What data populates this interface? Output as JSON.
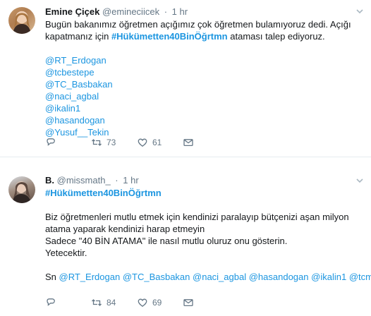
{
  "tweets": [
    {
      "name": "Emine Çiçek",
      "handle": "@emineciicek",
      "time": "1 hr",
      "lines": [
        [
          {
            "t": "Bugün bakanımız öğretmen açığımız çok öğretmen bulamıyoruz dedi. Açığı",
            "k": "text"
          }
        ],
        [
          {
            "t": "kapatmanız için ",
            "k": "text"
          },
          {
            "t": "#Hükümetten40BinÖğrtmn",
            "k": "hashtag"
          },
          {
            "t": "  ataması talep ediyoruz.",
            "k": "text"
          }
        ],
        [],
        [
          {
            "t": "@RT_Erdogan",
            "k": "link"
          }
        ],
        [
          {
            "t": "@tcbestepe",
            "k": "link"
          }
        ],
        [
          {
            "t": "@TC_Basbakan",
            "k": "link"
          }
        ],
        [
          {
            "t": "@naci_agbal",
            "k": "link"
          }
        ],
        [
          {
            "t": "@ikalin1",
            "k": "link"
          }
        ],
        [
          {
            "t": "@hasandogan",
            "k": "link"
          }
        ],
        [
          {
            "t": "@Yusuf__Tekin",
            "k": "link"
          }
        ]
      ],
      "actions": {
        "reply_count": "",
        "retweet_count": "73",
        "like_count": "61"
      }
    },
    {
      "name": "B.",
      "handle": "@missmath_",
      "time": "1 hr",
      "lines": [
        [
          {
            "t": "#Hükümetten40BinÖğrtmn",
            "k": "hashtag"
          }
        ],
        [],
        [
          {
            "t": "Biz öğretmenleri mutlu etmek için kendinizi paralayıp bütçenizi aşan milyon",
            "k": "text"
          }
        ],
        [
          {
            "t": "atama yaparak kendinizi harap etmeyin",
            "k": "text"
          }
        ],
        [
          {
            "t": "Sadece \"40 BİN ATAMA\" ile nasıl mutlu oluruz onu gösterin.",
            "k": "text"
          }
        ],
        [
          {
            "t": "Yetecektir.",
            "k": "text"
          }
        ],
        [],
        [
          {
            "t": "Sn ",
            "k": "text"
          },
          {
            "t": "@RT_Erdogan",
            "k": "link"
          },
          {
            "t": " ",
            "k": "text"
          },
          {
            "t": "@TC_Basbakan",
            "k": "link"
          },
          {
            "t": " ",
            "k": "text"
          },
          {
            "t": "@naci_agbal",
            "k": "link"
          },
          {
            "t": " ",
            "k": "text"
          },
          {
            "t": "@hasandogan",
            "k": "link"
          },
          {
            "t": " ",
            "k": "text"
          },
          {
            "t": "@ikalin1",
            "k": "link"
          },
          {
            "t": " ",
            "k": "text"
          },
          {
            "t": "@tcmeb",
            "k": "link"
          }
        ]
      ],
      "actions": {
        "reply_count": "",
        "retweet_count": "84",
        "like_count": "69"
      }
    }
  ],
  "icons": {
    "reply": "reply-icon",
    "retweet": "retweet-icon",
    "like": "heart-icon",
    "dm": "envelope-icon",
    "menu": "chevron-down-icon"
  },
  "colors": {
    "link": "#1b95e0",
    "muted": "#657786",
    "text": "#14171a",
    "divider": "#e6ecf0"
  }
}
